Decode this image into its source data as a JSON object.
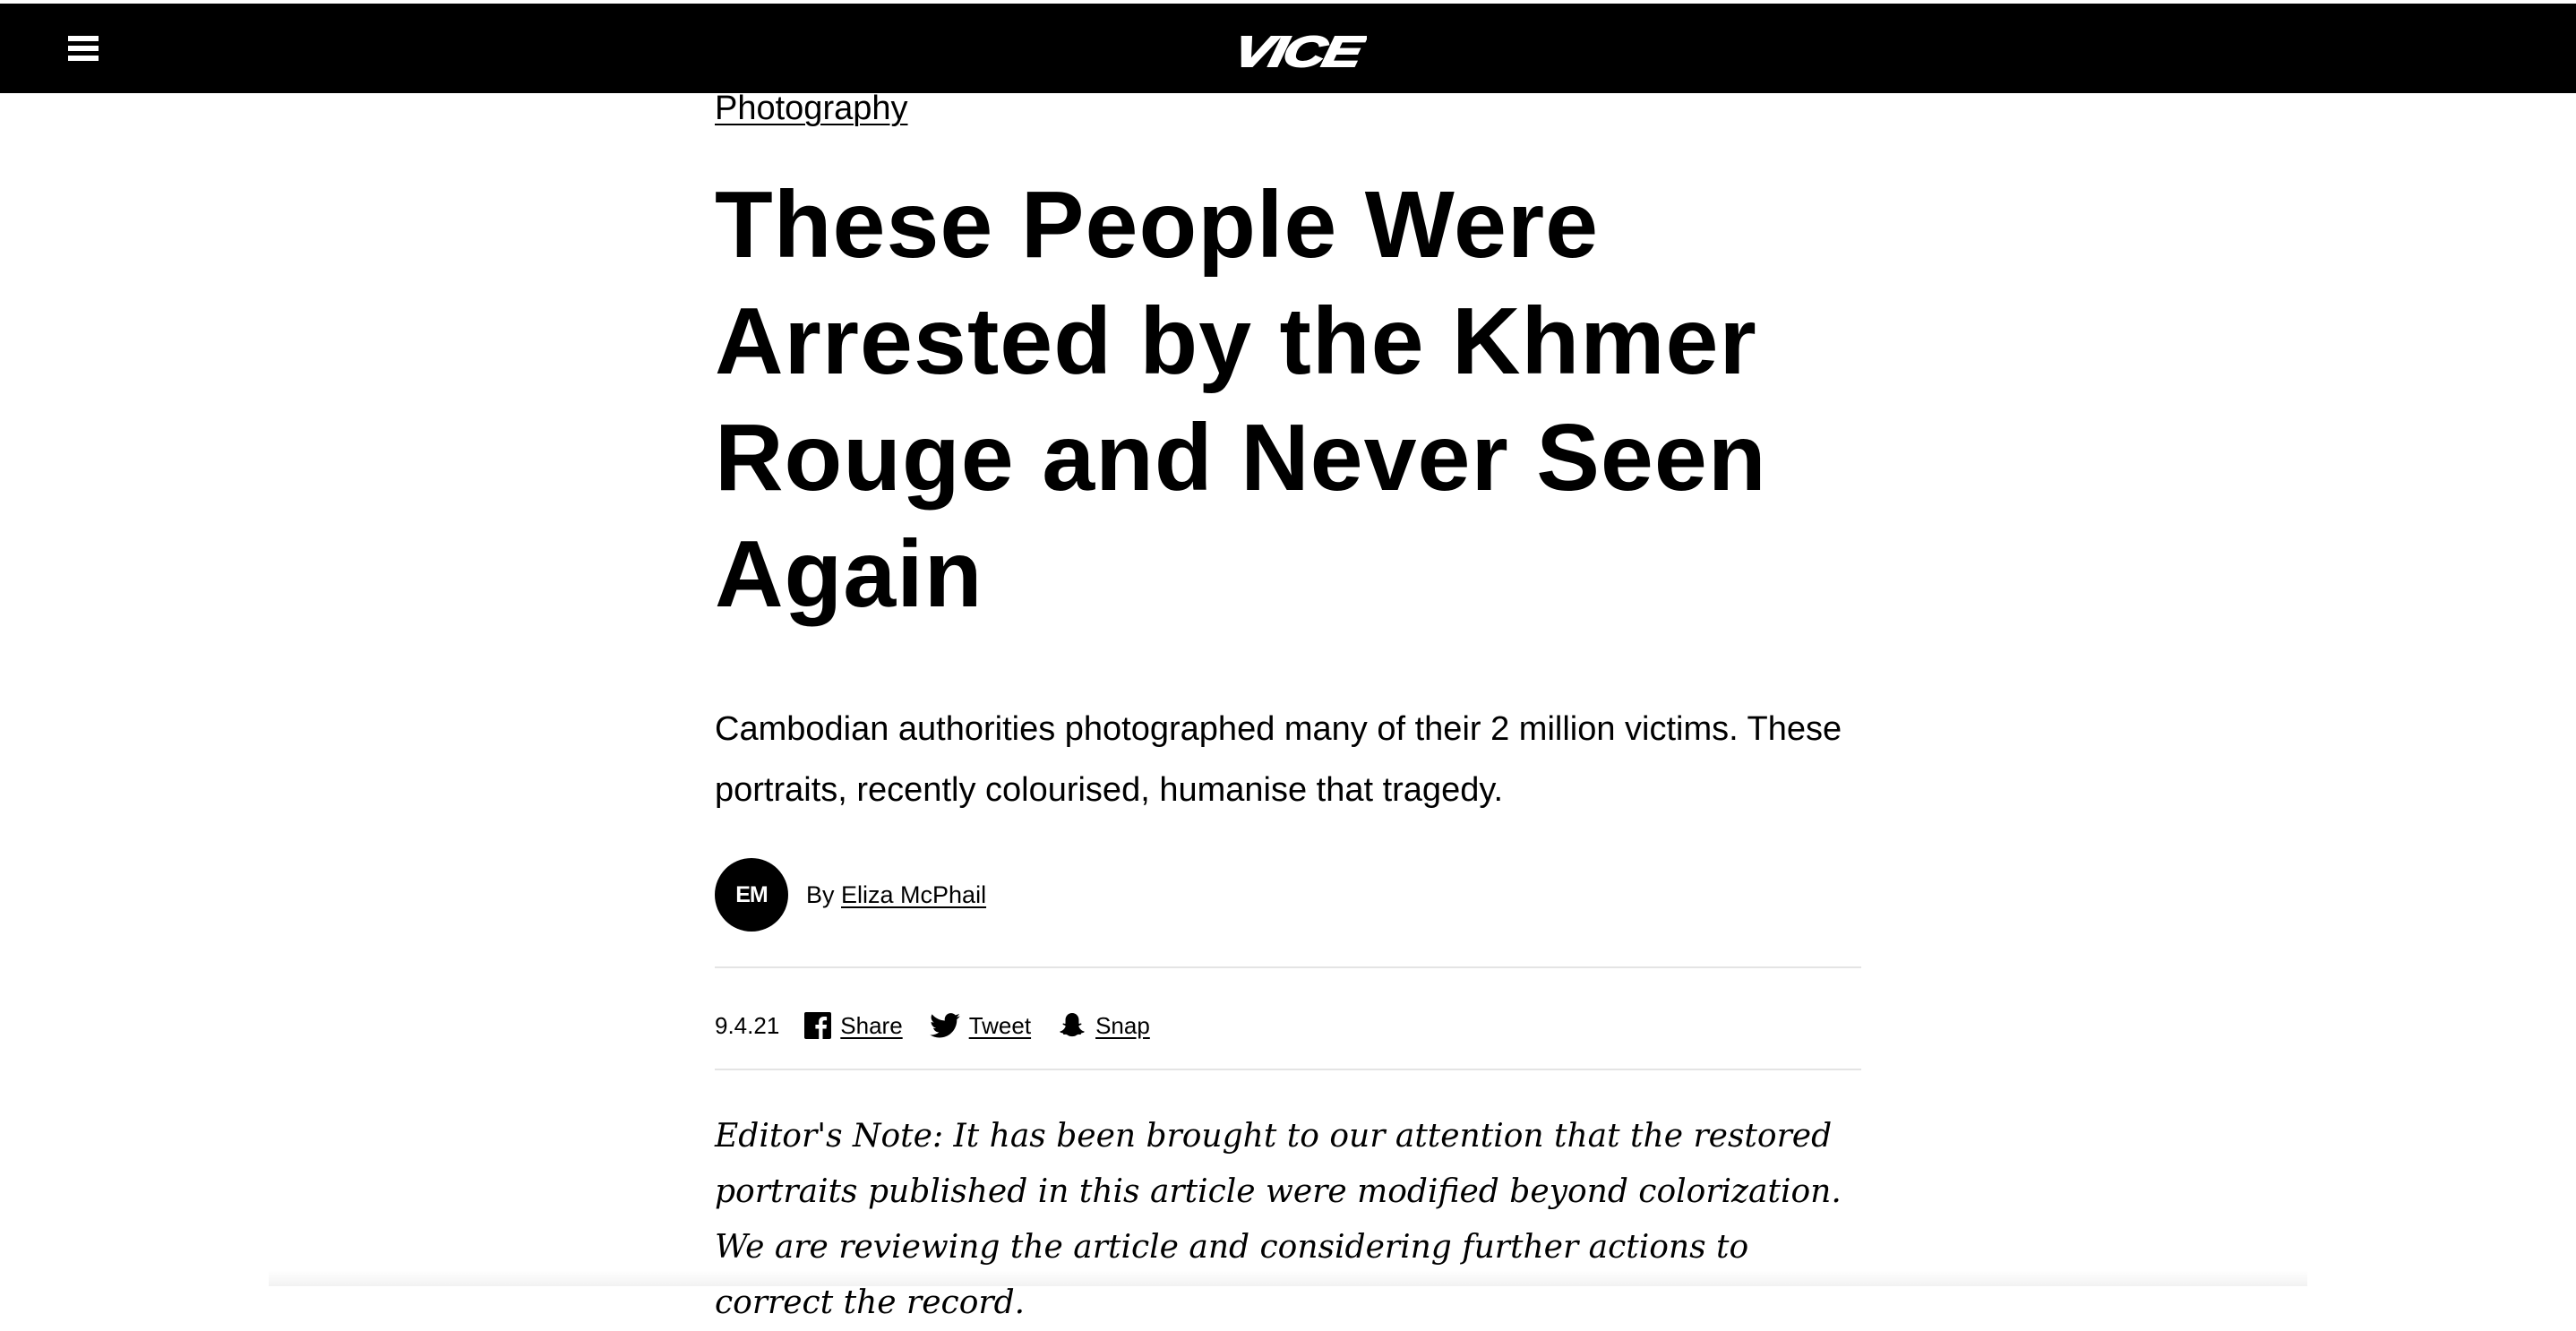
{
  "header": {
    "menu_icon": "hamburger-menu-icon",
    "logo_text": "VICE"
  },
  "article": {
    "section": "Photography",
    "title": "These People Were Arrested by the Khmer Rouge and Never Seen Again",
    "dek": "Cambodian authorities photographed many of their 2 million victims. These portraits, recently colourised, humanise that tragedy.",
    "author": {
      "initials": "EM",
      "by_prefix": "By ",
      "name": "Eliza McPhail"
    },
    "date": "9.4.21",
    "share": [
      {
        "label": "Share",
        "icon": "facebook-icon"
      },
      {
        "label": "Tweet",
        "icon": "twitter-icon"
      },
      {
        "label": "Snap",
        "icon": "snapchat-icon"
      }
    ],
    "editors_note": "Editor's Note: It has been brought to our attention that the restored portraits published in this article were modified beyond colorization. We are reviewing the article and considering further actions to correct the record."
  },
  "colors": {
    "header_bg": "#000000",
    "text": "#000000",
    "divider": "#e4e4e4"
  }
}
